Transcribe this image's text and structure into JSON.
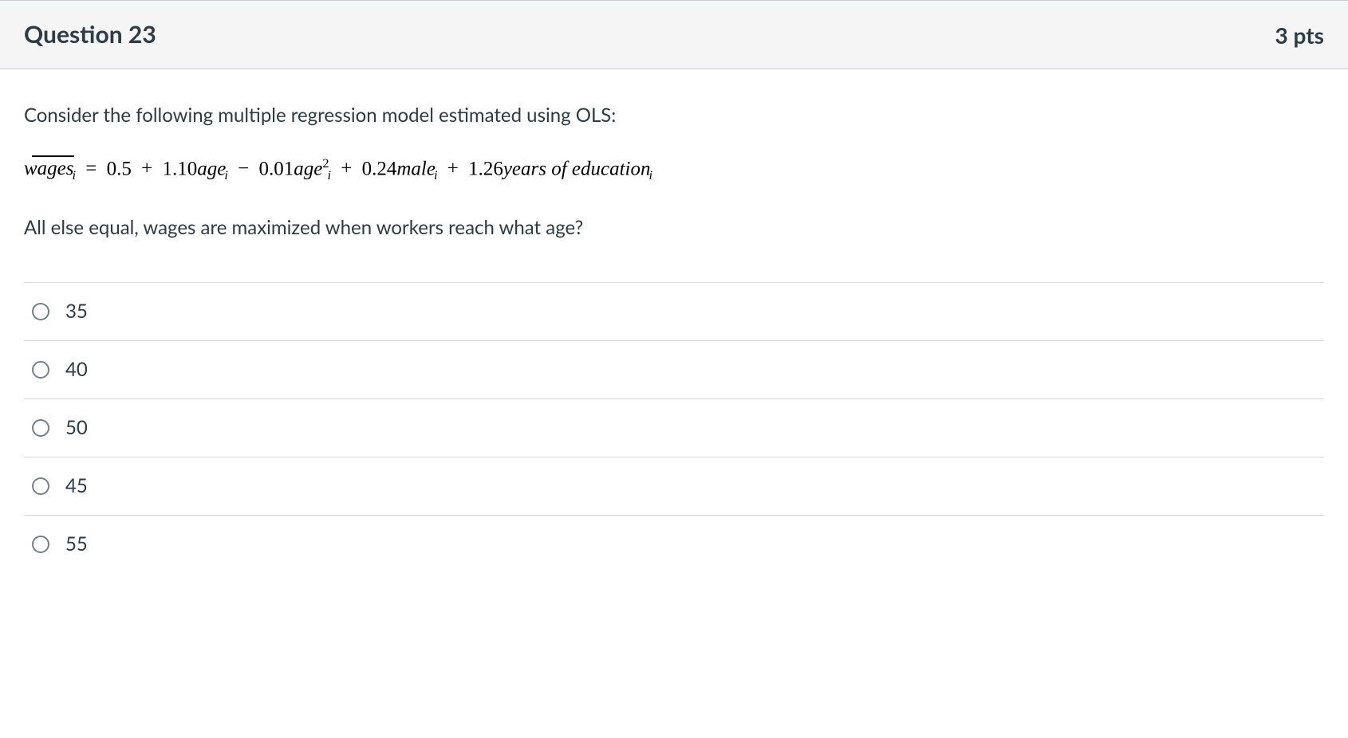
{
  "header": {
    "title": "Question 23",
    "points": "3 pts"
  },
  "body": {
    "intro": "Consider the following multiple regression model estimated using OLS:",
    "equation": {
      "lhs_hat": "wages",
      "lhs_sub": "i",
      "eq": "=",
      "c0": "0.5",
      "plus1": "+",
      "c1": "1.10",
      "v1": "age",
      "v1_sub": "i",
      "minus": "−",
      "c2": "0.01",
      "v2": "age",
      "v2_sup": "2",
      "v2_sub": "i",
      "plus3": "+",
      "c3": "0.24",
      "v3": "male",
      "v3_sub": "i",
      "plus4": "+",
      "c4": "1.26",
      "v4": "years of education",
      "v4_sub": "i"
    },
    "prompt": "All else equal, wages are maximized when workers reach what age?"
  },
  "options": [
    {
      "label": "35"
    },
    {
      "label": "40"
    },
    {
      "label": "50"
    },
    {
      "label": "45"
    },
    {
      "label": "55"
    }
  ]
}
